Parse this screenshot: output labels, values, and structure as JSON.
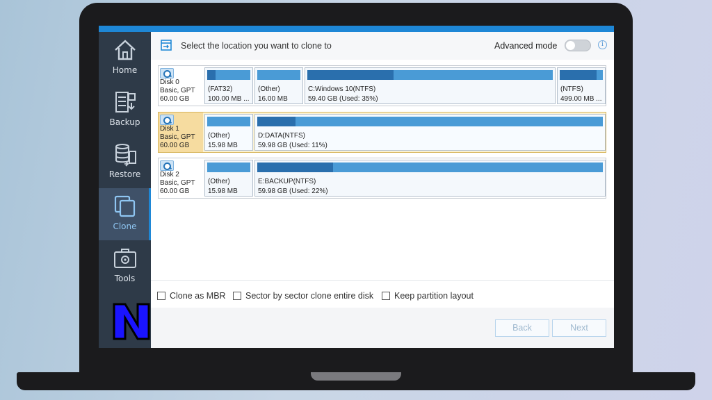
{
  "app": {
    "header_title": "Select the location you want to clone to",
    "advanced_mode_label": "Advanced mode",
    "advanced_mode_on": false,
    "info_glyph": "i",
    "accent_color": "#1e87d6"
  },
  "sidebar": {
    "items": [
      {
        "label": "Home",
        "icon": "home-icon",
        "active": false
      },
      {
        "label": "Backup",
        "icon": "backup-icon",
        "active": false
      },
      {
        "label": "Restore",
        "icon": "restore-icon",
        "active": false
      },
      {
        "label": "Clone",
        "icon": "clone-icon",
        "active": true
      },
      {
        "label": "Tools",
        "icon": "tools-icon",
        "active": false
      }
    ]
  },
  "disks": [
    {
      "name": "Disk 0",
      "type": "Basic, GPT",
      "size": "60.00 GB",
      "selected": false,
      "partitions": [
        {
          "line1": "(FAT32)",
          "line2": "100.00 MB ...",
          "used_fraction": 0.2
        },
        {
          "line1": "(Other)",
          "line2": "16.00 MB",
          "used_fraction": 0.0
        },
        {
          "line1": "C:Windows 10(NTFS)",
          "line2": "59.40 GB (Used: 35%)",
          "used_fraction": 0.35
        },
        {
          "line1": "(NTFS)",
          "line2": "499.00 MB ...",
          "used_fraction": 0.85
        }
      ]
    },
    {
      "name": "Disk 1",
      "type": "Basic, GPT",
      "size": "60.00 GB",
      "selected": true,
      "partitions": [
        {
          "line1": "(Other)",
          "line2": "15.98 MB",
          "used_fraction": 0.0
        },
        {
          "line1": "D:DATA(NTFS)",
          "line2": "59.98 GB (Used: 11%)",
          "used_fraction": 0.11
        }
      ]
    },
    {
      "name": "Disk 2",
      "type": "Basic, GPT",
      "size": "60.00 GB",
      "selected": false,
      "partitions": [
        {
          "line1": "(Other)",
          "line2": "15.98 MB",
          "used_fraction": 0.0
        },
        {
          "line1": "E:BACKUP(NTFS)",
          "line2": "59.98 GB (Used: 22%)",
          "used_fraction": 0.22
        }
      ]
    }
  ],
  "options": [
    {
      "label": "Clone as MBR",
      "checked": false
    },
    {
      "label": "Sector by sector clone entire disk",
      "checked": false
    },
    {
      "label": "Keep partition layout",
      "checked": false
    }
  ],
  "buttons": {
    "back": "Back",
    "next": "Next"
  }
}
